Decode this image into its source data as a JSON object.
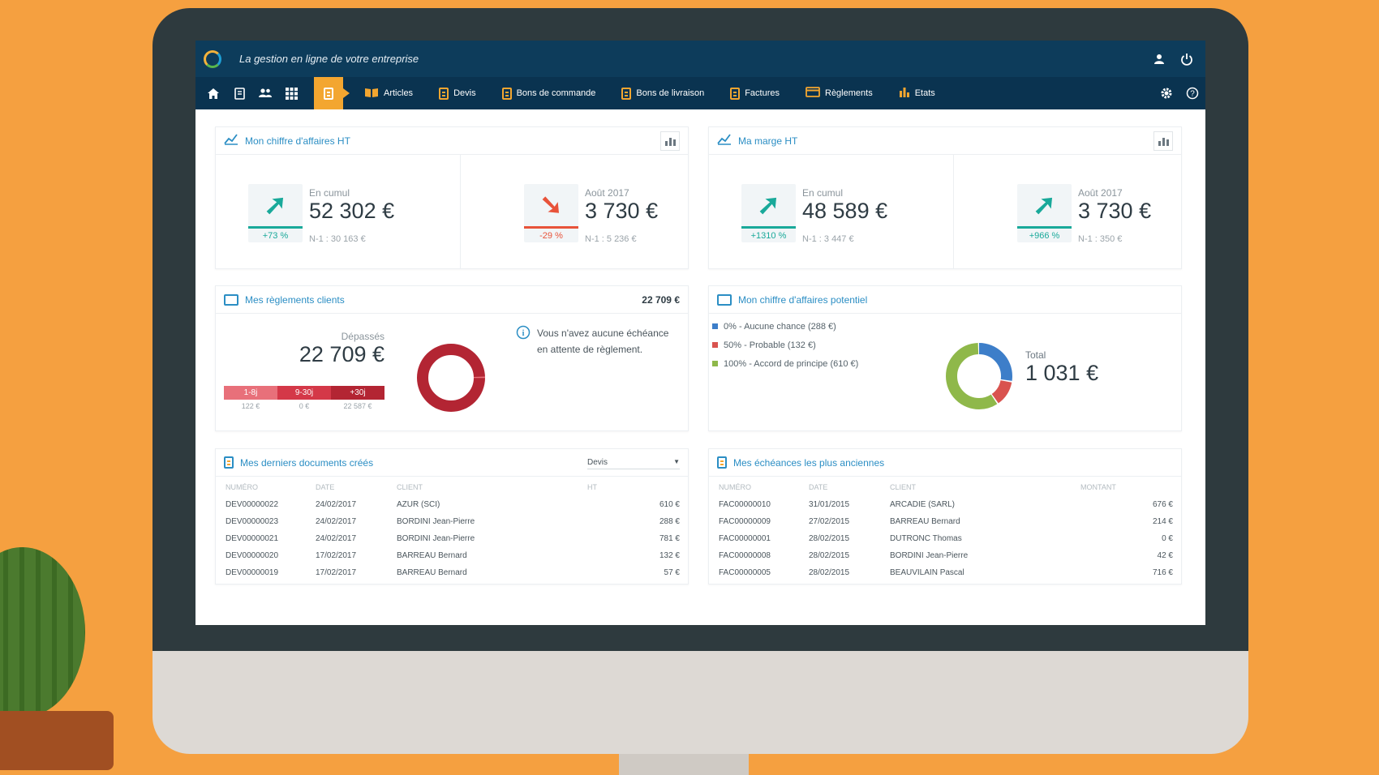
{
  "app": {
    "tagline": "La gestion en ligne de votre entreprise"
  },
  "nav": {
    "items": [
      {
        "label": "Articles",
        "icon": "book-icon"
      },
      {
        "label": "Devis",
        "icon": "document-icon"
      },
      {
        "label": "Bons de commande",
        "icon": "document-icon"
      },
      {
        "label": "Bons de livraison",
        "icon": "document-icon"
      },
      {
        "label": "Factures",
        "icon": "document-icon"
      },
      {
        "label": "Règlements",
        "icon": "card-icon"
      },
      {
        "label": "Etats",
        "icon": "bar-chart-icon"
      }
    ]
  },
  "ca": {
    "title": "Mon chiffre d'affaires HT",
    "cumul": {
      "label": "En cumul",
      "value": "52 302 €",
      "pct": "+73 %",
      "prev": "N-1 : 30 163 €",
      "trend": "up"
    },
    "month": {
      "label": "Août 2017",
      "value": "3 730 €",
      "pct": "-29 %",
      "prev": "N-1 : 5 236 €",
      "trend": "down"
    }
  },
  "marge": {
    "title": "Ma marge HT",
    "cumul": {
      "label": "En cumul",
      "value": "48 589 €",
      "pct": "+1310 %",
      "prev": "N-1 : 3 447 €",
      "trend": "up"
    },
    "month": {
      "label": "Août 2017",
      "value": "3 730 €",
      "pct": "+966 %",
      "prev": "N-1 : 350 €",
      "trend": "up"
    }
  },
  "reglements": {
    "title": "Mes règlements clients",
    "total": "22 709 €",
    "overdue_label": "Dépassés",
    "overdue_value": "22 709 €",
    "buckets": [
      {
        "label": "1-8j",
        "amount": "122 €",
        "color": "#e8707a"
      },
      {
        "label": "9-30j",
        "amount": "0 €",
        "color": "#d43848"
      },
      {
        "label": "+30j",
        "amount": "22 587 €",
        "color": "#b32533"
      }
    ],
    "info": "Vous n'avez aucune échéance en attente de règlement."
  },
  "potentiel": {
    "title": "Mon chiffre d'affaires potentiel",
    "total_label": "Total",
    "total_value": "1 031 €",
    "legend": [
      {
        "label": "0% - Aucune chance (288 €)",
        "value": 288,
        "color": "#3d7ec9"
      },
      {
        "label": "50% - Probable (132 €)",
        "value": 132,
        "color": "#d9534f"
      },
      {
        "label": "100% - Accord de principe (610 €)",
        "value": 610,
        "color": "#8fb84a"
      }
    ]
  },
  "documents": {
    "title": "Mes derniers documents créés",
    "filter": "Devis",
    "headers": [
      "NUMÉRO",
      "DATE",
      "CLIENT",
      "HT"
    ],
    "rows": [
      [
        "DEV00000022",
        "24/02/2017",
        "AZUR (SCI)",
        "610 €"
      ],
      [
        "DEV00000023",
        "24/02/2017",
        "BORDINI Jean-Pierre",
        "288 €"
      ],
      [
        "DEV00000021",
        "24/02/2017",
        "BORDINI Jean-Pierre",
        "781 €"
      ],
      [
        "DEV00000020",
        "17/02/2017",
        "BARREAU Bernard",
        "132 €"
      ],
      [
        "DEV00000019",
        "17/02/2017",
        "BARREAU Bernard",
        "57 €"
      ]
    ]
  },
  "echeances": {
    "title": "Mes échéances les plus anciennes",
    "headers": [
      "NUMÉRO",
      "DATE",
      "CLIENT",
      "MONTANT"
    ],
    "rows": [
      [
        "FAC00000010",
        "31/01/2015",
        "ARCADIE (SARL)",
        "676 €"
      ],
      [
        "FAC00000009",
        "27/02/2015",
        "BARREAU Bernard",
        "214 €"
      ],
      [
        "FAC00000001",
        "28/02/2015",
        "DUTRONC Thomas",
        "0 €"
      ],
      [
        "FAC00000008",
        "28/02/2015",
        "BORDINI Jean-Pierre",
        "42 €"
      ],
      [
        "FAC00000005",
        "28/02/2015",
        "BEAUVILAIN Pascal",
        "716 €"
      ]
    ]
  },
  "colors": {
    "topbar": "#0d3c5b",
    "accent": "#f3a630",
    "link": "#2b8ec4",
    "up": "#19a99a",
    "down": "#e8533a"
  }
}
